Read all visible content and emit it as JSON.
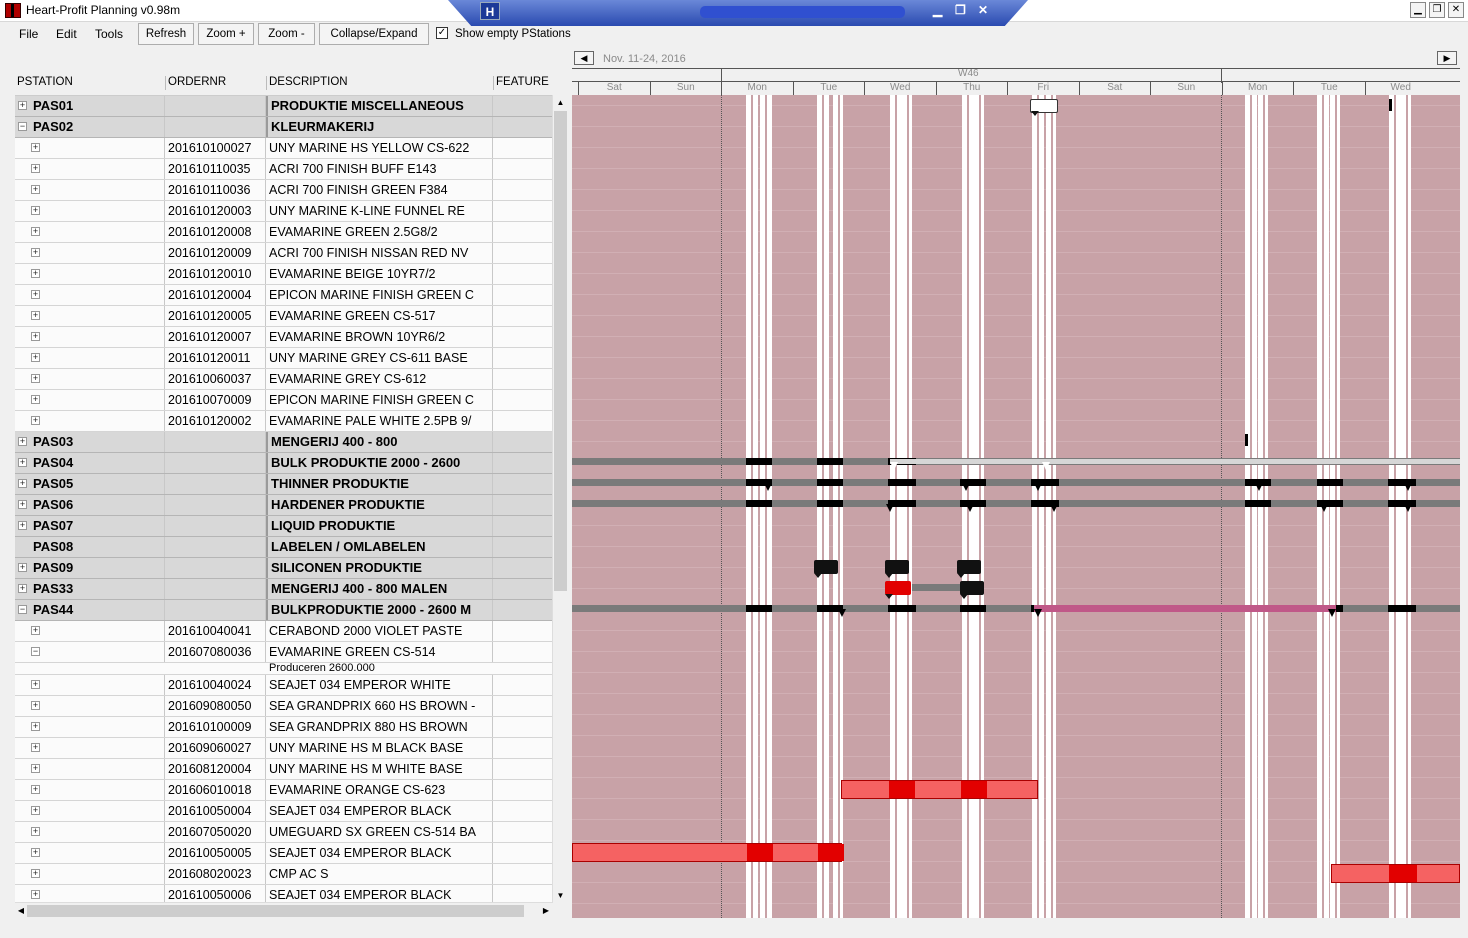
{
  "window": {
    "title": "Heart-Profit Planning v0.98m",
    "logo": "H"
  },
  "menu": [
    "File",
    "Edit",
    "Tools"
  ],
  "toolbar": {
    "refresh": "Refresh",
    "zoom_in": "Zoom +",
    "zoom_out": "Zoom -",
    "collapse": "Collapse/Expand",
    "show_empty_label": "Show empty PStations",
    "show_empty_checked": true
  },
  "columns": [
    "PSTATION",
    "ORDERNR",
    "DESCRIPTION",
    "FEATURE"
  ],
  "rows": [
    {
      "type": "group",
      "pstation": "PAS01",
      "order": "",
      "desc": "PRODUKTIE MISCELLANEOUS",
      "exp": "+"
    },
    {
      "type": "group",
      "pstation": "PAS02",
      "order": "",
      "desc": "KLEURMAKERIJ",
      "exp": "−"
    },
    {
      "type": "child",
      "order": "201610100027",
      "desc": "UNY MARINE HS YELLOW CS-622",
      "exp": "+"
    },
    {
      "type": "child",
      "order": "201610110035",
      "desc": "ACRI 700 FINISH BUFF E143",
      "exp": "+"
    },
    {
      "type": "child",
      "order": "201610110036",
      "desc": "ACRI 700 FINISH GREEN F384",
      "exp": "+"
    },
    {
      "type": "child",
      "order": "201610120003",
      "desc": "UNY MARINE  K-LINE FUNNEL RE",
      "exp": "+"
    },
    {
      "type": "child",
      "order": "201610120008",
      "desc": "EVAMARINE GREEN 2.5G8/2",
      "exp": "+"
    },
    {
      "type": "child",
      "order": "201610120009",
      "desc": "ACRI 700 FINISH NISSAN RED NV",
      "exp": "+"
    },
    {
      "type": "child",
      "order": "201610120010",
      "desc": "EVAMARINE BEIGE 10YR7/2",
      "exp": "+"
    },
    {
      "type": "child",
      "order": "201610120004",
      "desc": "EPICON MARINE FINISH GREEN C",
      "exp": "+"
    },
    {
      "type": "child",
      "order": "201610120005",
      "desc": "EVAMARINE GREEN CS-517",
      "exp": "+"
    },
    {
      "type": "child",
      "order": "201610120007",
      "desc": "EVAMARINE BROWN 10YR6/2",
      "exp": "+"
    },
    {
      "type": "child",
      "order": "201610120011",
      "desc": "UNY MARINE GREY CS-611 BASE",
      "exp": "+"
    },
    {
      "type": "child",
      "order": "201610060037",
      "desc": "EVAMARINE GREY CS-612",
      "exp": "+"
    },
    {
      "type": "child",
      "order": "201610070009",
      "desc": "EPICON MARINE FINISH GREEN C",
      "exp": "+"
    },
    {
      "type": "child",
      "order": "201610120002",
      "desc": "EVAMARINE PALE WHITE 2.5PB 9/",
      "exp": "+"
    },
    {
      "type": "group",
      "pstation": "PAS03",
      "order": "",
      "desc": "MENGERIJ 400 - 800",
      "exp": "+"
    },
    {
      "type": "group",
      "pstation": "PAS04",
      "order": "",
      "desc": "BULK PRODUKTIE 2000 - 2600",
      "exp": "+"
    },
    {
      "type": "group",
      "pstation": "PAS05",
      "order": "",
      "desc": "THINNER PRODUKTIE",
      "exp": "+"
    },
    {
      "type": "group",
      "pstation": "PAS06",
      "order": "",
      "desc": "HARDENER PRODUKTIE",
      "exp": "+"
    },
    {
      "type": "group",
      "pstation": "PAS07",
      "order": "",
      "desc": "LIQUID PRODUKTIE",
      "exp": "+"
    },
    {
      "type": "group",
      "pstation": "PAS08",
      "order": "",
      "desc": "LABELEN / OMLABELEN",
      "exp": ""
    },
    {
      "type": "group",
      "pstation": "PAS09",
      "order": "",
      "desc": "SILICONEN PRODUKTIE",
      "exp": "+"
    },
    {
      "type": "group",
      "pstation": "PAS33",
      "order": "",
      "desc": "MENGERIJ 400 - 800 MALEN",
      "exp": "+"
    },
    {
      "type": "group",
      "pstation": "PAS44",
      "order": "",
      "desc": "BULKPRODUKTIE 2000 - 2600 M",
      "exp": "−"
    },
    {
      "type": "child",
      "order": "201610040041",
      "desc": "CERABOND 2000 VIOLET PASTE",
      "exp": "+"
    },
    {
      "type": "child",
      "order": "201607080036",
      "desc": "EVAMARINE GREEN CS-514",
      "exp": "−"
    },
    {
      "type": "sub",
      "desc": "Produceren 2600.000"
    },
    {
      "type": "child",
      "order": "201610040024",
      "desc": "SEAJET 034 EMPEROR WHITE",
      "exp": "+"
    },
    {
      "type": "child",
      "order": "201609080050",
      "desc": "SEA GRANDPRIX 660 HS BROWN -",
      "exp": "+"
    },
    {
      "type": "child",
      "order": "201610100009",
      "desc": "SEA GRANDPRIX 880 HS BROWN",
      "exp": "+"
    },
    {
      "type": "child",
      "order": "201609060027",
      "desc": "UNY MARINE HS M BLACK BASE",
      "exp": "+"
    },
    {
      "type": "child",
      "order": "201608120004",
      "desc": "UNY MARINE HS M WHITE BASE",
      "exp": "+"
    },
    {
      "type": "child",
      "order": "201606010018",
      "desc": "EVAMARINE ORANGE CS-623",
      "exp": "+"
    },
    {
      "type": "child",
      "order": "201610050004",
      "desc": "SEAJET 034 EMPEROR BLACK",
      "exp": "+"
    },
    {
      "type": "child",
      "order": "201607050020",
      "desc": "UMEGUARD SX GREEN CS-514 BA",
      "exp": "+"
    },
    {
      "type": "child",
      "order": "201610050005",
      "desc": "SEAJET 034 EMPEROR BLACK",
      "exp": "+"
    },
    {
      "type": "child",
      "order": "201608020023",
      "desc": "CMP AC S",
      "exp": "+"
    },
    {
      "type": "child",
      "order": "201610050006",
      "desc": "SEAJET 034 EMPEROR BLACK",
      "exp": "+"
    }
  ],
  "timeline": {
    "range": "Nov. 11-24, 2016",
    "week": "W46",
    "days": [
      "Sat",
      "Sun",
      "Mon",
      "Tue",
      "Wed",
      "Thu",
      "Fri",
      "Sat",
      "Sun",
      "Mon",
      "Tue",
      "Wed"
    ],
    "colors": {
      "background": "#c8a2a7",
      "bar": "#f56262",
      "bar_active": "#e20000",
      "track": "#7a7a7a",
      "pink_track": "#c05888"
    }
  },
  "icons": {
    "prev": "triangle-left-icon",
    "next": "triangle-right-icon",
    "minimize": "minimize-icon",
    "restore": "restore-icon",
    "close": "close-icon"
  }
}
